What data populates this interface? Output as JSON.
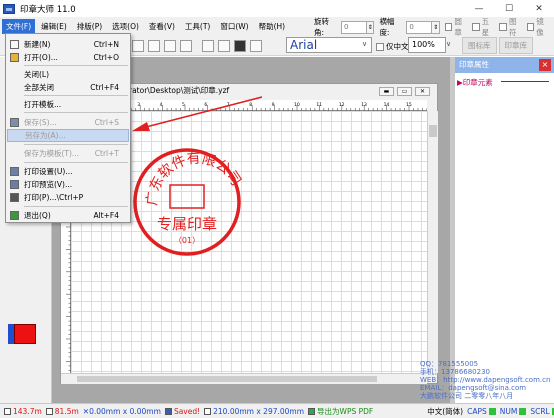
{
  "window": {
    "title": "印章大师 11.0",
    "minimize": "—",
    "maximize": "☐",
    "close": "✕"
  },
  "menubar": [
    "文件(F)",
    "编辑(E)",
    "排版(P)",
    "选项(O)",
    "查看(V)",
    "工具(T)",
    "窗口(W)",
    "帮助(H)"
  ],
  "toolbar": {
    "rotate_label": "旋转角:",
    "rotate_value": "0",
    "width_label": "横幅度:",
    "width_value": "0",
    "circle_seal": "圆章",
    "five_star": "五星",
    "text_label": "图符",
    "mirror": "镜像",
    "font_name": "Arial",
    "vertical": "仅中文",
    "zoom": "100%",
    "tab_library": "图标库",
    "tab_seal_library": "印章库"
  },
  "document": {
    "title": "rator\\Desktop\\测试\\印章.yzf",
    "ruler_numbers": [
      "1",
      "2",
      "3",
      "4",
      "5",
      "6",
      "7",
      "8",
      "9",
      "10",
      "11",
      "12",
      "13",
      "14",
      "15",
      "16"
    ],
    "seal": {
      "top_text": "广东软件有限公司",
      "main_text": "专属印章",
      "number": "（01）",
      "color": "#e02020"
    }
  },
  "right_panel": {
    "title": "印章属性",
    "section": "印章元素"
  },
  "info": {
    "qq": "QQ：781555005",
    "phone": "手机：13786680230",
    "web": "WEB：http://www.dapengsoft.com.cn",
    "email": "EMAIL：dapengsoft@sina.com",
    "company": "大鹏软件公司 二零零八年八月"
  },
  "statusbar": {
    "w": "143.7m",
    "h": "81.5m",
    "size": "0.00mm x 0.00mm",
    "saved": "Saved!",
    "paper": "210.00mm x 297.00mm",
    "export": "导出为WPS PDF",
    "lang": "中文(简体)",
    "caps": "CAPS",
    "num": "NUM",
    "scrl": "SCRL"
  },
  "file_menu": [
    {
      "label": "新建(N)",
      "shortcut": "Ctrl+N",
      "enabled": true,
      "icon": "new-file-icon"
    },
    {
      "label": "打开(O)...",
      "shortcut": "Ctrl+O",
      "enabled": true,
      "icon": "open-folder-icon"
    },
    {
      "label": "关闭(L)",
      "shortcut": "",
      "enabled": true,
      "icon": ""
    },
    {
      "label": "全部关闭",
      "shortcut": "Ctrl+F4",
      "enabled": true,
      "icon": ""
    },
    {
      "label": "打开模板...",
      "shortcut": "",
      "enabled": true,
      "icon": ""
    },
    {
      "label": "保存(S)...",
      "shortcut": "Ctrl+S",
      "enabled": false,
      "icon": "save-icon"
    },
    {
      "label": "另存为(A)...",
      "shortcut": "",
      "enabled": false,
      "icon": ""
    },
    {
      "label": "保存为模板(T)...",
      "shortcut": "Ctrl+T",
      "enabled": false,
      "icon": ""
    },
    {
      "label": "打印设置(U)...",
      "shortcut": "",
      "enabled": true,
      "icon": "print-setup-icon"
    },
    {
      "label": "打印预览(V)...",
      "shortcut": "",
      "enabled": true,
      "icon": "print-preview-icon"
    },
    {
      "label": "打印(P)...\\Ctrl+P",
      "shortcut": "",
      "enabled": true,
      "icon": "print-icon"
    },
    {
      "label": "退出(Q)",
      "shortcut": "Alt+F4",
      "enabled": true,
      "icon": "exit-icon"
    }
  ]
}
